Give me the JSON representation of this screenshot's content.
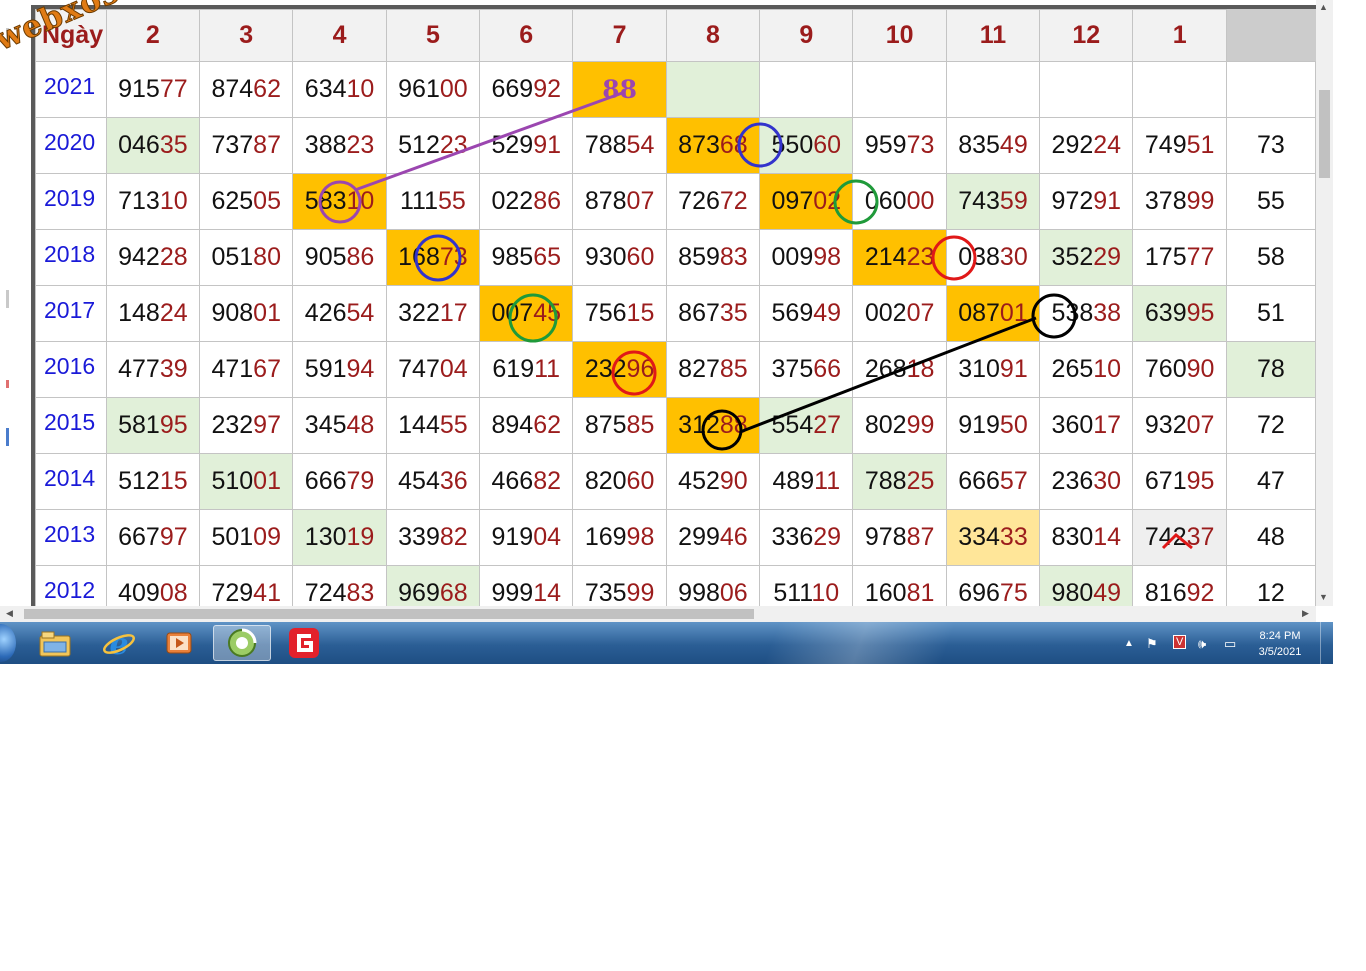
{
  "watermark": "webxoso.net",
  "columns": [
    "Ngày",
    "2",
    "3",
    "4",
    "5",
    "6",
    "7",
    "8",
    "9",
    "10",
    "11",
    "12",
    "1"
  ],
  "rows": [
    {
      "year": "2021",
      "cells": [
        [
          "915",
          "77"
        ],
        [
          "874",
          "62"
        ],
        [
          "634",
          "10"
        ],
        [
          "961",
          "00"
        ],
        [
          "669",
          "92"
        ],
        [
          "",
          "88"
        ],
        [
          "",
          ""
        ],
        [
          "",
          ""
        ],
        [
          "",
          ""
        ],
        [
          "",
          ""
        ],
        [
          "",
          ""
        ],
        [
          "",
          ""
        ],
        [
          "",
          ""
        ]
      ],
      "styles": [
        "",
        "",
        "",
        "",
        "",
        "orange",
        "green",
        "",
        "",
        "",
        "",
        "",
        ""
      ]
    },
    {
      "year": "2020",
      "cells": [
        [
          "046",
          "35"
        ],
        [
          "737",
          "87"
        ],
        [
          "388",
          "23"
        ],
        [
          "512",
          "23"
        ],
        [
          "529",
          "91"
        ],
        [
          "788",
          "54"
        ],
        [
          "873",
          "68"
        ],
        [
          "550",
          "60"
        ],
        [
          "959",
          "73"
        ],
        [
          "835",
          "49"
        ],
        [
          "292",
          "24"
        ],
        [
          "749",
          "51"
        ],
        [
          "73",
          ""
        ]
      ],
      "styles": [
        "green",
        "",
        "",
        "",
        "",
        "",
        "orange",
        "green",
        "",
        "",
        "",
        "",
        ""
      ]
    },
    {
      "year": "2019",
      "cells": [
        [
          "713",
          "10"
        ],
        [
          "625",
          "05"
        ],
        [
          "583",
          "10"
        ],
        [
          "111",
          "55"
        ],
        [
          "022",
          "86"
        ],
        [
          "878",
          "07"
        ],
        [
          "726",
          "72"
        ],
        [
          "097",
          "02"
        ],
        [
          "060",
          "00"
        ],
        [
          "743",
          "59"
        ],
        [
          "972",
          "91"
        ],
        [
          "378",
          "99"
        ],
        [
          "55",
          ""
        ]
      ],
      "styles": [
        "",
        "",
        "orange",
        "",
        "",
        "",
        "",
        "orange",
        "",
        "green",
        "",
        "",
        ""
      ]
    },
    {
      "year": "2018",
      "cells": [
        [
          "942",
          "28"
        ],
        [
          "051",
          "80"
        ],
        [
          "905",
          "86"
        ],
        [
          "168",
          "73"
        ],
        [
          "985",
          "65"
        ],
        [
          "930",
          "60"
        ],
        [
          "859",
          "83"
        ],
        [
          "009",
          "98"
        ],
        [
          "214",
          "23"
        ],
        [
          "038",
          "30"
        ],
        [
          "352",
          "29"
        ],
        [
          "175",
          "77"
        ],
        [
          "58",
          ""
        ]
      ],
      "styles": [
        "",
        "",
        "",
        "orange",
        "",
        "",
        "",
        "",
        "orange",
        "",
        "green",
        "",
        ""
      ]
    },
    {
      "year": "2017",
      "cells": [
        [
          "148",
          "24"
        ],
        [
          "908",
          "01"
        ],
        [
          "426",
          "54"
        ],
        [
          "322",
          "17"
        ],
        [
          "007",
          "45"
        ],
        [
          "756",
          "15"
        ],
        [
          "867",
          "35"
        ],
        [
          "569",
          "49"
        ],
        [
          "002",
          "07"
        ],
        [
          "087",
          "01"
        ],
        [
          "538",
          "38"
        ],
        [
          "639",
          "95"
        ],
        [
          "51",
          ""
        ]
      ],
      "styles": [
        "",
        "",
        "",
        "",
        "orange",
        "",
        "",
        "",
        "",
        "orange",
        "",
        "green",
        ""
      ]
    },
    {
      "year": "2016",
      "cells": [
        [
          "477",
          "39"
        ],
        [
          "471",
          "67"
        ],
        [
          "591",
          "94"
        ],
        [
          "747",
          "04"
        ],
        [
          "619",
          "11"
        ],
        [
          "232",
          "96"
        ],
        [
          "827",
          "85"
        ],
        [
          "375",
          "66"
        ],
        [
          "268",
          "18"
        ],
        [
          "310",
          "91"
        ],
        [
          "265",
          "10"
        ],
        [
          "760",
          "90"
        ],
        [
          "78",
          ""
        ]
      ],
      "styles": [
        "",
        "",
        "",
        "",
        "",
        "orange",
        "",
        "",
        "",
        "",
        "",
        "",
        "green"
      ]
    },
    {
      "year": "2015",
      "cells": [
        [
          "581",
          "95"
        ],
        [
          "232",
          "97"
        ],
        [
          "345",
          "48"
        ],
        [
          "144",
          "55"
        ],
        [
          "894",
          "62"
        ],
        [
          "875",
          "85"
        ],
        [
          "312",
          "88"
        ],
        [
          "554",
          "27"
        ],
        [
          "802",
          "99"
        ],
        [
          "919",
          "50"
        ],
        [
          "360",
          "17"
        ],
        [
          "932",
          "07"
        ],
        [
          "72",
          ""
        ]
      ],
      "styles": [
        "green",
        "",
        "",
        "",
        "",
        "",
        "orange",
        "green",
        "",
        "",
        "",
        "",
        ""
      ]
    },
    {
      "year": "2014",
      "cells": [
        [
          "512",
          "15"
        ],
        [
          "510",
          "01"
        ],
        [
          "666",
          "79"
        ],
        [
          "454",
          "36"
        ],
        [
          "466",
          "82"
        ],
        [
          "820",
          "60"
        ],
        [
          "452",
          "90"
        ],
        [
          "489",
          "11"
        ],
        [
          "788",
          "25"
        ],
        [
          "666",
          "57"
        ],
        [
          "236",
          "30"
        ],
        [
          "671",
          "95"
        ],
        [
          "47",
          ""
        ]
      ],
      "styles": [
        "",
        "green",
        "",
        "",
        "",
        "",
        "",
        "",
        "green",
        "",
        "",
        "",
        ""
      ]
    },
    {
      "year": "2013",
      "cells": [
        [
          "667",
          "97"
        ],
        [
          "501",
          "09"
        ],
        [
          "130",
          "19"
        ],
        [
          "339",
          "82"
        ],
        [
          "919",
          "04"
        ],
        [
          "169",
          "98"
        ],
        [
          "299",
          "46"
        ],
        [
          "336",
          "29"
        ],
        [
          "978",
          "87"
        ],
        [
          "334",
          "33"
        ],
        [
          "830",
          "14"
        ],
        [
          "742",
          "37"
        ],
        [
          "48",
          ""
        ]
      ],
      "styles": [
        "",
        "",
        "green",
        "",
        "",
        "",
        "",
        "",
        "",
        "lightorange",
        "",
        "grey",
        ""
      ]
    },
    {
      "year": "2012",
      "cells": [
        [
          "409",
          "08"
        ],
        [
          "729",
          "41"
        ],
        [
          "724",
          "83"
        ],
        [
          "969",
          "68"
        ],
        [
          "999",
          "14"
        ],
        [
          "735",
          "99"
        ],
        [
          "998",
          "06"
        ],
        [
          "511",
          "10"
        ],
        [
          "160",
          "81"
        ],
        [
          "696",
          "75"
        ],
        [
          "980",
          "49"
        ],
        [
          "816",
          "92"
        ],
        [
          "12",
          ""
        ]
      ],
      "styles": [
        "",
        "",
        "",
        "green",
        "",
        "",
        "",
        "",
        "",
        "",
        "green",
        "",
        ""
      ]
    }
  ],
  "taskbar": {
    "apps": [
      {
        "name": "file-explorer-icon"
      },
      {
        "name": "internet-explorer-icon"
      },
      {
        "name": "media-player-icon"
      },
      {
        "name": "coccoc-browser-icon",
        "active": true
      },
      {
        "name": "garena-icon"
      }
    ],
    "tray_icons": [
      "arrow-up-icon",
      "flag-icon",
      "v-icon",
      "speaker-icon",
      "network-icon"
    ],
    "time": "8:24 PM",
    "date": "3/5/2021"
  },
  "colors": {
    "highlight_orange": "#ffc000",
    "highlight_green": "#e1f0d9",
    "tail_red": "#9b1c1c",
    "year_blue": "#1a1ad8",
    "circle_purple": "#9b46b0",
    "circle_blue": "#3333cc",
    "circle_green": "#1f9a3a",
    "circle_red": "#e01818",
    "circle_black": "#000000"
  }
}
